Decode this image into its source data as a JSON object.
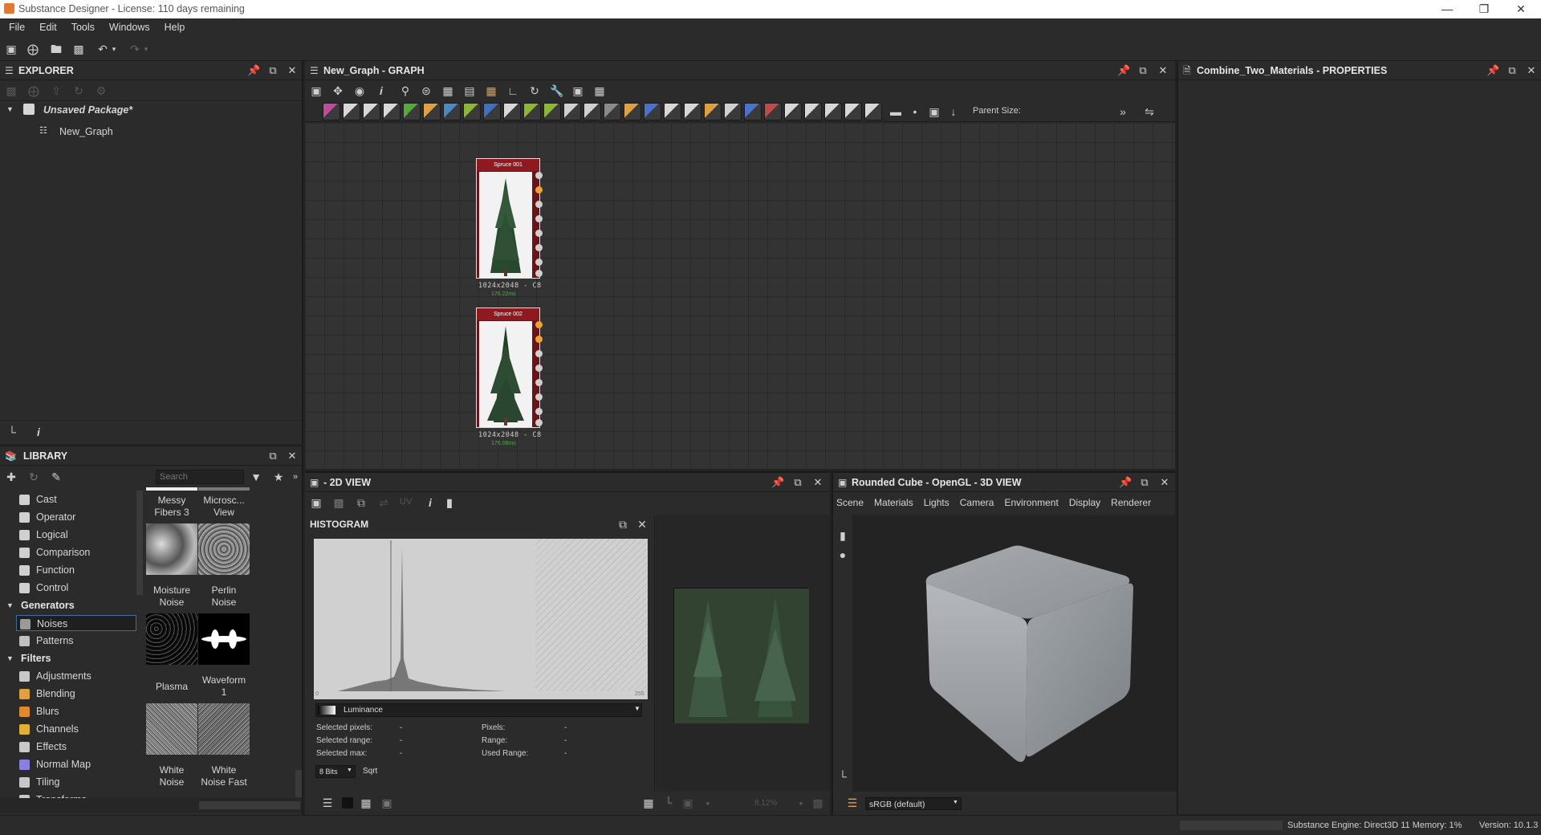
{
  "window": {
    "title": "Substance Designer - License: 110 days remaining"
  },
  "menu": [
    "File",
    "Edit",
    "Tools",
    "Windows",
    "Help"
  ],
  "explorer": {
    "title": "EXPLORER",
    "package": "Unsaved Package*",
    "graph": "New_Graph"
  },
  "graph_panel": {
    "title": "New_Graph - GRAPH",
    "parent_size_label": "Parent Size:",
    "nodes": [
      {
        "title": "Spruce 001",
        "size": "1024x2048 - C8",
        "time": "176.22ms"
      },
      {
        "title": "Spruce 002",
        "size": "1024x2048 - C8",
        "time": "176.08ms"
      }
    ]
  },
  "properties": {
    "title": "Combine_Two_Materials - PROPERTIES"
  },
  "library": {
    "title": "LIBRARY",
    "search_placeholder": "Search",
    "categories": [
      {
        "label": "Cast",
        "type": "item",
        "color": "#d0d0d0"
      },
      {
        "label": "Operator",
        "type": "item",
        "color": "#d0d0d0"
      },
      {
        "label": "Logical",
        "type": "item",
        "color": "#d0d0d0"
      },
      {
        "label": "Comparison",
        "type": "item",
        "color": "#d0d0d0"
      },
      {
        "label": "Function",
        "type": "item",
        "color": "#d0d0d0"
      },
      {
        "label": "Control",
        "type": "item",
        "color": "#d0d0d0"
      },
      {
        "label": "Generators",
        "type": "group",
        "color": ""
      },
      {
        "label": "Noises",
        "type": "item",
        "color": "#9a9a9a",
        "selected": true
      },
      {
        "label": "Patterns",
        "type": "item",
        "color": "#c0c0c0"
      },
      {
        "label": "Filters",
        "type": "group",
        "color": ""
      },
      {
        "label": "Adjustments",
        "type": "item",
        "color": "#c8c8c8"
      },
      {
        "label": "Blending",
        "type": "item",
        "color": "#e0a040"
      },
      {
        "label": "Blurs",
        "type": "item",
        "color": "#e08a30"
      },
      {
        "label": "Channels",
        "type": "item",
        "color": "#e0b030"
      },
      {
        "label": "Effects",
        "type": "item",
        "color": "#c8c8c8"
      },
      {
        "label": "Normal Map",
        "type": "item",
        "color": "#8a80e0"
      },
      {
        "label": "Tiling",
        "type": "item",
        "color": "#c8c8c8"
      },
      {
        "label": "Transforms",
        "type": "item",
        "color": "#c8c8c8"
      }
    ],
    "thumbs": [
      {
        "label1": "Messy",
        "label2": "Fibers 3"
      },
      {
        "label1": "Microsc...",
        "label2": "View"
      },
      {
        "label1": "Moisture",
        "label2": "Noise"
      },
      {
        "label1": "Perlin",
        "label2": "Noise"
      },
      {
        "label1": "Plasma",
        "label2": ""
      },
      {
        "label1": "Waveform",
        "label2": "1"
      },
      {
        "label1": "White",
        "label2": "Noise"
      },
      {
        "label1": "White",
        "label2": "Noise Fast"
      }
    ]
  },
  "view2d": {
    "title": "- 2D VIEW",
    "uv_label": "UV",
    "zoom": "8.12%"
  },
  "histogram": {
    "title": "HISTOGRAM",
    "axis_min": "0",
    "axis_max": "255",
    "channel": "Luminance",
    "stats_left": [
      {
        "label": "Selected pixels:",
        "value": "-"
      },
      {
        "label": "Selected range:",
        "value": "-"
      },
      {
        "label": "Selected max:",
        "value": "-"
      }
    ],
    "stats_right": [
      {
        "label": "Pixels:",
        "value": "-"
      },
      {
        "label": "Range:",
        "value": "-"
      },
      {
        "label": "Used Range:",
        "value": "-"
      }
    ],
    "bits": "8 Bits",
    "sqrt": "Sqrt"
  },
  "view3d": {
    "title": "Rounded Cube - OpenGL - 3D VIEW",
    "tabs": [
      "Scene",
      "Materials",
      "Lights",
      "Camera",
      "Environment",
      "Display",
      "Renderer"
    ],
    "colorspace": "sRGB (default)"
  },
  "statusbar": {
    "engine": "Substance Engine: Direct3D 11 Memory: 1%",
    "version": "Version: 10.1.3"
  }
}
